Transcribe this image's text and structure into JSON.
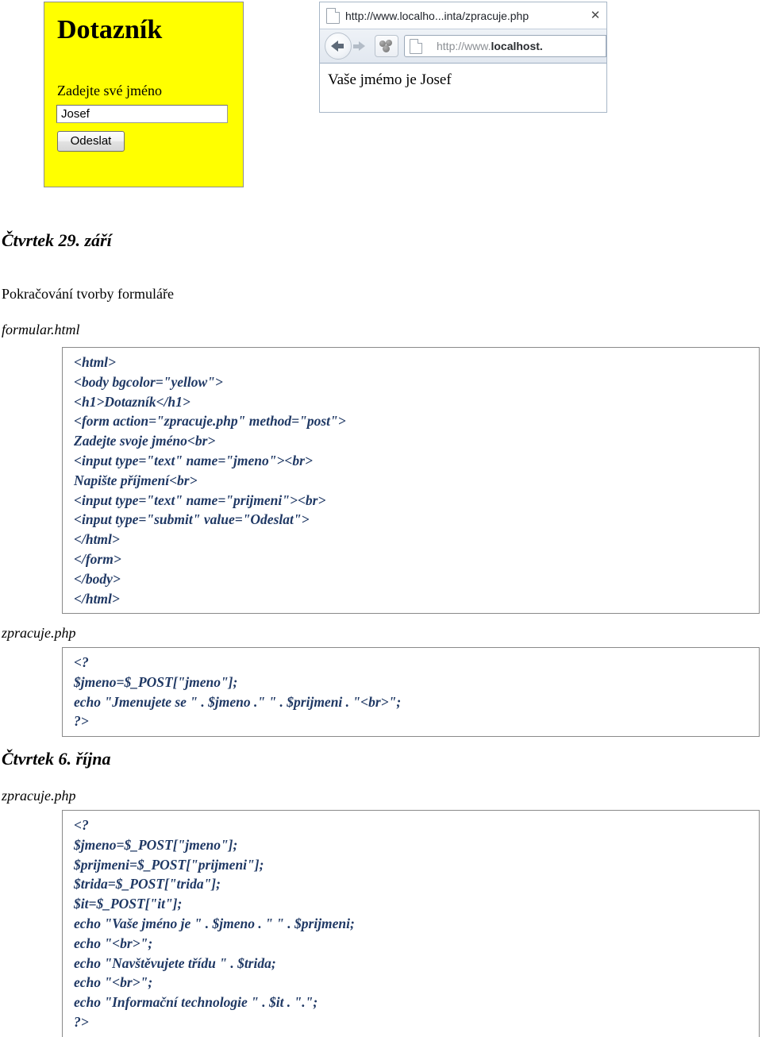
{
  "screenshot_form": {
    "title": "Dotazník",
    "field_label": "Zadejte své jméno",
    "input_value": "Josef",
    "submit_label": "Odeslat",
    "background_color": "#ffff00"
  },
  "screenshot_browser": {
    "tab_title": "http://www.localho...inta/zpracuje.php",
    "tab_close_glyph": "✕",
    "url_text_prefix": "http://www.",
    "url_text_bold": "localhost.",
    "page_output": "Vaše jmémo je Josef"
  },
  "document": {
    "section_one": {
      "date_heading": "Čtvrtek 29. září",
      "subtitle": "Pokračování tvorby formuláře",
      "file_one_label": "formular.html",
      "file_one_code": [
        "<html>",
        "<body bgcolor=\"yellow\">",
        "<h1>Dotazník</h1>",
        "<form action=\"zpracuje.php\" method=\"post\">",
        "Zadejte svoje jméno<br>",
        "<input type=\"text\" name=\"jmeno\"><br>",
        "Napište příjmení<br>",
        "<input type=\"text\" name=\"prijmeni\"><br>",
        "<input type=\"submit\" value=\"Odeslat\">",
        "</html>",
        "</form>",
        "</body>",
        "</html>"
      ],
      "file_two_label": "zpracuje.php",
      "file_two_code": [
        "<?",
        "$jmeno=$_POST[\"jmeno\"];",
        "echo \"Jmenujete se \" . $jmeno .\" \" . $prijmeni . \"<br>\";",
        "?>"
      ]
    },
    "section_two": {
      "date_heading": "Čtvrtek 6. října",
      "file_label": "zpracuje.php",
      "code": [
        "<?",
        "$jmeno=$_POST[\"jmeno\"];",
        "$prijmeni=$_POST[\"prijmeni\"];",
        "$trida=$_POST[\"trida\"];",
        "$it=$_POST[\"it\"];",
        "echo \"Vaše jméno je \" . $jmeno . \" \" . $prijmeni;",
        "echo \"<br>\";",
        "echo \"Navštěvujete třídu \" . $trida;",
        "echo \"<br>\";",
        "echo \"Informační technologie \" . $it . \".\";",
        "?>"
      ]
    }
  },
  "colors": {
    "code_text": "#1f3864",
    "code_border": "#8a8a8a",
    "form_background": "#ffff00"
  }
}
